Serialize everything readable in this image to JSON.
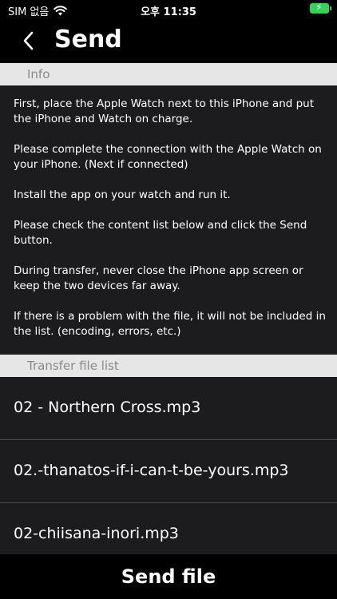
{
  "status": {
    "carrier": "SIM 없음",
    "time": "오후 11:35",
    "wifi_icon": "wifi-icon",
    "battery_icon": "battery-charging-icon",
    "battery_color": "#33d35a"
  },
  "nav": {
    "title": "Send",
    "back_icon": "chevron-left-icon"
  },
  "info": {
    "header": "Info",
    "paragraphs": [
      "First, place the Apple Watch next to this iPhone and put the iPhone and Watch on charge.",
      "Please complete the connection with the Apple Watch on your iPhone. (Next if connected)",
      "Install the app on your watch and run it.",
      "Please check the content list below and click the Send button.",
      "During transfer, never close the iPhone app screen or keep the two devices far away.",
      "If there is a problem with the file, it will not be included in the list. (encoding, errors, etc.)"
    ]
  },
  "transfer": {
    "header": "Transfer file list",
    "files": [
      "02 - Northern Cross.mp3",
      "02.-thanatos-if-i-can-t-be-yours.mp3",
      "02-chiisana-inori.mp3"
    ]
  },
  "footer": {
    "send_label": "Send file"
  }
}
